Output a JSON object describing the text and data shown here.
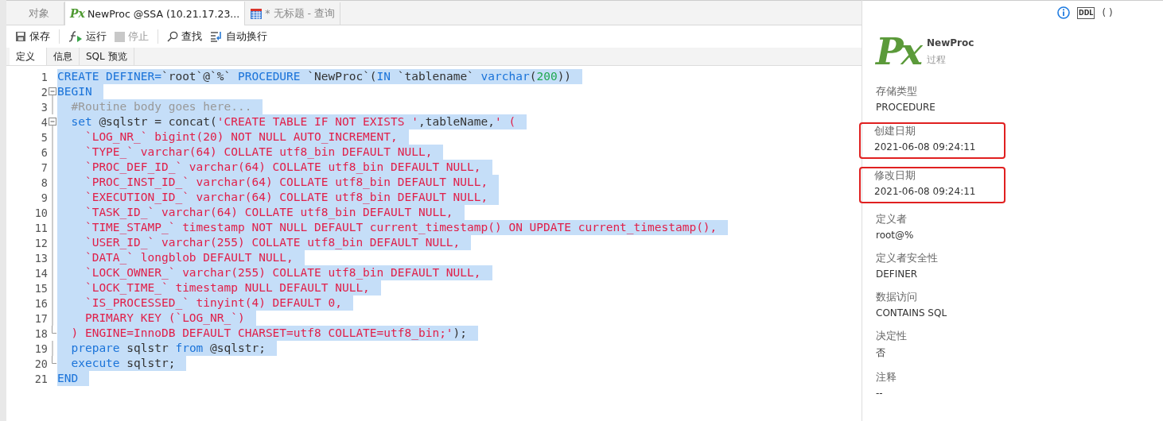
{
  "tabs": [
    {
      "label": "对象",
      "selected": false,
      "kind": "plain"
    },
    {
      "label": "NewProc @SSA (10.21.17.23...",
      "selected": true,
      "kind": "procedure",
      "icon_text": "Px"
    },
    {
      "label": "* 无标题 - 查询",
      "selected": false,
      "kind": "query"
    }
  ],
  "toolbar": [
    {
      "label": "保存",
      "kind": "save",
      "disabled": false
    },
    {
      "label": "运行",
      "kind": "run",
      "disabled": false
    },
    {
      "label": "停止",
      "kind": "stop",
      "disabled": true
    },
    {
      "label": "查找",
      "kind": "find",
      "disabled": false
    },
    {
      "label": "自动换行",
      "kind": "wrap",
      "disabled": false
    }
  ],
  "subtabs": [
    {
      "label": "定义",
      "selected": true
    },
    {
      "label": "信息",
      "selected": false
    },
    {
      "label": "SQL 预览",
      "selected": false
    }
  ],
  "code_lines": [
    {
      "number": "1",
      "kind": "plain",
      "segments": [
        {
          "kind": "kw",
          "text": "CREATE DEFINER="
        },
        {
          "kind": "plain",
          "text": "`root`@`%` "
        },
        {
          "kind": "kw",
          "text": "PROCEDURE "
        },
        {
          "kind": "plain",
          "text": "`NewProc`("
        },
        {
          "kind": "kw",
          "text": "IN "
        },
        {
          "kind": "plain",
          "text": "`tablename` "
        },
        {
          "kind": "kw",
          "text": "varchar"
        },
        {
          "kind": "plain",
          "text": "("
        },
        {
          "kind": "num",
          "text": "200"
        },
        {
          "kind": "plain",
          "text": "))"
        }
      ]
    },
    {
      "number": "2",
      "kind": "fold-start",
      "segments": [
        {
          "kind": "kw",
          "text": "BEGIN"
        }
      ]
    },
    {
      "number": "3",
      "kind": "fold-body",
      "segments": [
        {
          "kind": "comment",
          "text": "  #Routine body goes here..."
        }
      ]
    },
    {
      "number": "4",
      "kind": "fold-start",
      "segments": [
        {
          "kind": "kw",
          "text": "  set "
        },
        {
          "kind": "plain",
          "text": "@sqlstr = concat("
        },
        {
          "kind": "str",
          "text": "'CREATE TABLE IF NOT EXISTS '"
        },
        {
          "kind": "plain",
          "text": ",tableName,"
        },
        {
          "kind": "str",
          "text": "' ("
        }
      ]
    },
    {
      "number": "5",
      "kind": "fold-body",
      "segments": [
        {
          "kind": "str",
          "text": "    `LOG_NR_` bigint(20) NOT NULL AUTO_INCREMENT,"
        }
      ]
    },
    {
      "number": "6",
      "kind": "fold-body",
      "segments": [
        {
          "kind": "str",
          "text": "    `TYPE_` varchar(64) COLLATE utf8_bin DEFAULT NULL,"
        }
      ]
    },
    {
      "number": "7",
      "kind": "fold-body",
      "segments": [
        {
          "kind": "str",
          "text": "    `PROC_DEF_ID_` varchar(64) COLLATE utf8_bin DEFAULT NULL,"
        }
      ]
    },
    {
      "number": "8",
      "kind": "fold-body",
      "segments": [
        {
          "kind": "str",
          "text": "    `PROC_INST_ID_` varchar(64) COLLATE utf8_bin DEFAULT NULL,"
        }
      ]
    },
    {
      "number": "9",
      "kind": "fold-body",
      "segments": [
        {
          "kind": "str",
          "text": "    `EXECUTION_ID_` varchar(64) COLLATE utf8_bin DEFAULT NULL,"
        }
      ]
    },
    {
      "number": "10",
      "kind": "fold-body",
      "segments": [
        {
          "kind": "str",
          "text": "    `TASK_ID_` varchar(64) COLLATE utf8_bin DEFAULT NULL,"
        }
      ]
    },
    {
      "number": "11",
      "kind": "fold-body",
      "segments": [
        {
          "kind": "str",
          "text": "    `TIME_STAMP_` timestamp NOT NULL DEFAULT current_timestamp() ON UPDATE current_timestamp(),"
        }
      ]
    },
    {
      "number": "12",
      "kind": "fold-body",
      "segments": [
        {
          "kind": "str",
          "text": "    `USER_ID_` varchar(255) COLLATE utf8_bin DEFAULT NULL,"
        }
      ]
    },
    {
      "number": "13",
      "kind": "fold-body",
      "segments": [
        {
          "kind": "str",
          "text": "    `DATA_` longblob DEFAULT NULL,"
        }
      ]
    },
    {
      "number": "14",
      "kind": "fold-body",
      "segments": [
        {
          "kind": "str",
          "text": "    `LOCK_OWNER_` varchar(255) COLLATE utf8_bin DEFAULT NULL,"
        }
      ]
    },
    {
      "number": "15",
      "kind": "fold-body",
      "segments": [
        {
          "kind": "str",
          "text": "    `LOCK_TIME_` timestamp NULL DEFAULT NULL,"
        }
      ]
    },
    {
      "number": "16",
      "kind": "fold-body",
      "segments": [
        {
          "kind": "str",
          "text": "    `IS_PROCESSED_` tinyint(4) DEFAULT 0,"
        }
      ]
    },
    {
      "number": "17",
      "kind": "fold-body",
      "segments": [
        {
          "kind": "str",
          "text": "    PRIMARY KEY (`LOG_NR_`)"
        }
      ]
    },
    {
      "number": "18",
      "kind": "fold-end",
      "segments": [
        {
          "kind": "str",
          "text": "  ) ENGINE=InnoDB DEFAULT CHARSET=utf8 COLLATE=utf8_bin;'"
        },
        {
          "kind": "plain",
          "text": ");"
        }
      ]
    },
    {
      "number": "19",
      "kind": "fold-body",
      "segments": [
        {
          "kind": "kw",
          "text": "  prepare "
        },
        {
          "kind": "plain",
          "text": "sqlstr "
        },
        {
          "kind": "kw",
          "text": "from "
        },
        {
          "kind": "plain",
          "text": "@sqlstr;"
        }
      ]
    },
    {
      "number": "20",
      "kind": "fold-end",
      "segments": [
        {
          "kind": "kw",
          "text": "  execute "
        },
        {
          "kind": "plain",
          "text": "sqlstr;"
        }
      ]
    },
    {
      "number": "21",
      "kind": "plain",
      "segments": [
        {
          "kind": "kw",
          "text": "END"
        }
      ]
    }
  ],
  "info_panel": {
    "header_buttons": [
      {
        "kind": "info"
      },
      {
        "kind": "ddl",
        "label": "DDL"
      },
      {
        "kind": "parens",
        "label": "( )"
      }
    ],
    "logo": "Px",
    "name": "NewProc",
    "type": "过程",
    "properties": [
      {
        "label": "存储类型",
        "value": "PROCEDURE",
        "highlighted": false
      },
      {
        "label": "创建日期",
        "value": "2021-06-08 09:24:11",
        "highlighted": true
      },
      {
        "label": "修改日期",
        "value": "2021-06-08 09:24:11",
        "highlighted": true
      },
      {
        "label": "定义者",
        "value": "root@%",
        "highlighted": false
      },
      {
        "label": "定义者安全性",
        "value": "DEFINER",
        "highlighted": false
      },
      {
        "label": "数据访问",
        "value": "CONTAINS SQL",
        "highlighted": false
      },
      {
        "label": "决定性",
        "value": "否",
        "highlighted": false
      },
      {
        "label": "注释",
        "value": "--",
        "highlighted": false
      }
    ]
  }
}
